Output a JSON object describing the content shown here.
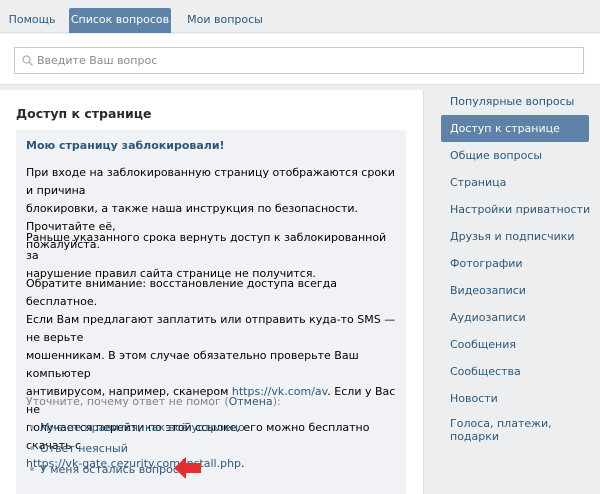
{
  "tabs": [
    {
      "label": "Помощь"
    },
    {
      "label": "Список вопросов"
    },
    {
      "label": "Мои вопросы"
    }
  ],
  "search": {
    "placeholder": "Введите Ваш вопрос",
    "value": ""
  },
  "main": {
    "title": "Доступ к странице",
    "answer": {
      "title": "Мою страницу заблокировали!",
      "p1_lines": [
        "При входе на заблокированную страницу отображаются сроки и причина",
        "блокировки, а также наша инструкция по безопасности. Прочитайте её,",
        "пожалуйста."
      ],
      "p2_lines": [
        "Раньше указанного срока вернуть доступ к заблокированной за",
        "нарушение правил сайта странице не получится."
      ],
      "p3": {
        "line1": "Обратите внимание: восстановление доступа всегда бесплатное.",
        "line2": "Если Вам предлагают заплатить или отправить куда-то SMS — не верьте",
        "line3": "мошенникам. В этом случае обязательно проверьте Ваш компьютер",
        "line4_pre": "антивирусом, например, сканером ",
        "link1": "https://vk.com/av",
        "line4_post": ". Если у Вас не",
        "line5": "получается перейти по этой ссылке, его можно бесплатно скачать с",
        "link2": "https://vk-gate.cezurity.com/install.php",
        "line6_post": "."
      },
      "hint_pre": "Уточните, почему ответ не помог (",
      "hint_link": "Отмена",
      "hint_post": "):",
      "options": [
        "Мне не нравится, как всё устроено",
        "Ответ неясный",
        "У меня остались вопросы"
      ]
    }
  },
  "sidebar": {
    "items": [
      {
        "label": "Популярные вопросы"
      },
      {
        "label": "Доступ к странице"
      },
      {
        "label": "Общие вопросы"
      },
      {
        "label": "Страница"
      },
      {
        "label": "Настройки приватности"
      },
      {
        "label": "Друзья и подписчики"
      },
      {
        "label": "Фотографии"
      },
      {
        "label": "Видеозаписи"
      },
      {
        "label": "Аудиозаписи"
      },
      {
        "label": "Сообщения"
      },
      {
        "label": "Сообщества"
      },
      {
        "label": "Новости"
      },
      {
        "label": "Голоса, платежи, подарки"
      }
    ]
  },
  "colors": {
    "accent": "#5e82a8",
    "link": "#2b587a",
    "background": "#edeef0",
    "answer_bg": "#f0f2f5",
    "arrow": "#e0302e"
  },
  "icons": {
    "search": "magnifier-icon",
    "bullet": "dot-icon",
    "pointer": "red-arrow-icon"
  }
}
